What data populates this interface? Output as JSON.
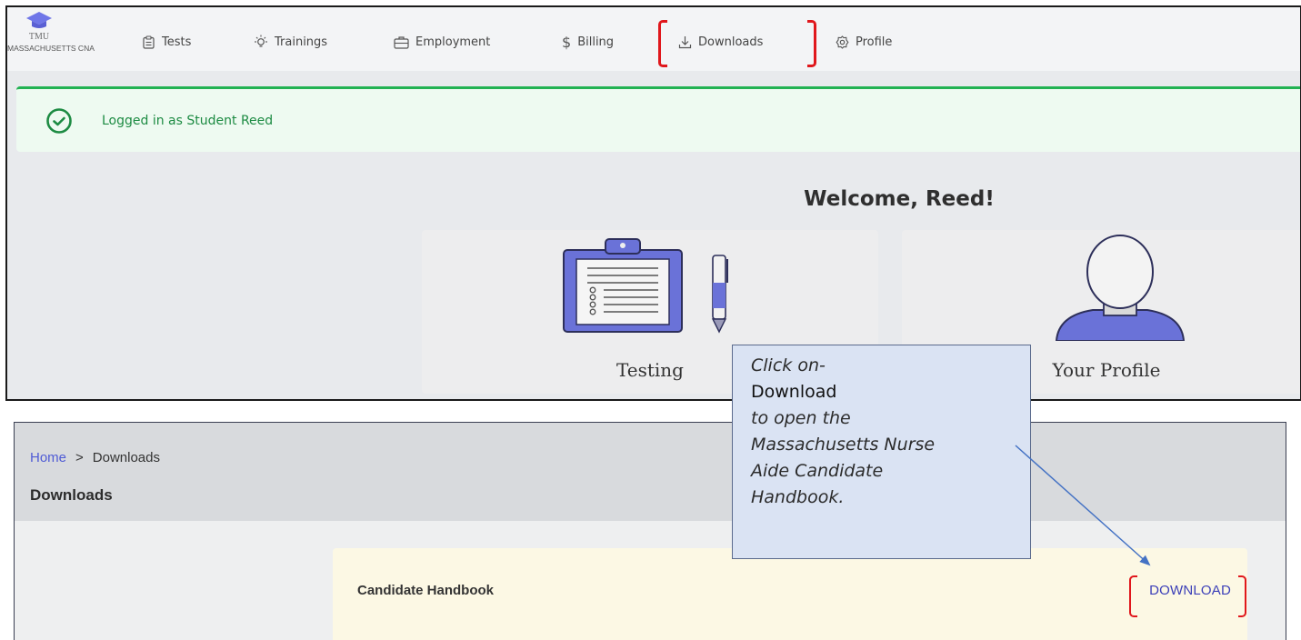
{
  "logo": {
    "name": "TMU",
    "subtitle": "MASSACHUSETTS CNA"
  },
  "nav": {
    "tests": "Tests",
    "trainings": "Trainings",
    "employment": "Employment",
    "billing": "Billing",
    "downloads": "Downloads",
    "profile": "Profile"
  },
  "alert": {
    "text": "Logged in as Student Reed"
  },
  "welcome": "Welcome, Reed!",
  "cards": {
    "testing": "Testing",
    "profile": "Your Profile"
  },
  "callout": {
    "line1": "Click on-",
    "line2": "Download",
    "line3": "to open the",
    "line4": "Massachusetts Nurse",
    "line5": "Aide Candidate",
    "line6": "Handbook."
  },
  "downloads_page": {
    "breadcrumb_home": "Home",
    "breadcrumb_sep": ">",
    "breadcrumb_current": "Downloads",
    "heading": "Downloads",
    "item_title": "Candidate Handbook",
    "item_button": "DOWNLOAD"
  },
  "colors": {
    "highlight": "#e0171c",
    "success": "#22b253",
    "link": "#4f5bd5",
    "callout_bg": "#dae3f3",
    "card_bg": "#fcf8e4"
  }
}
